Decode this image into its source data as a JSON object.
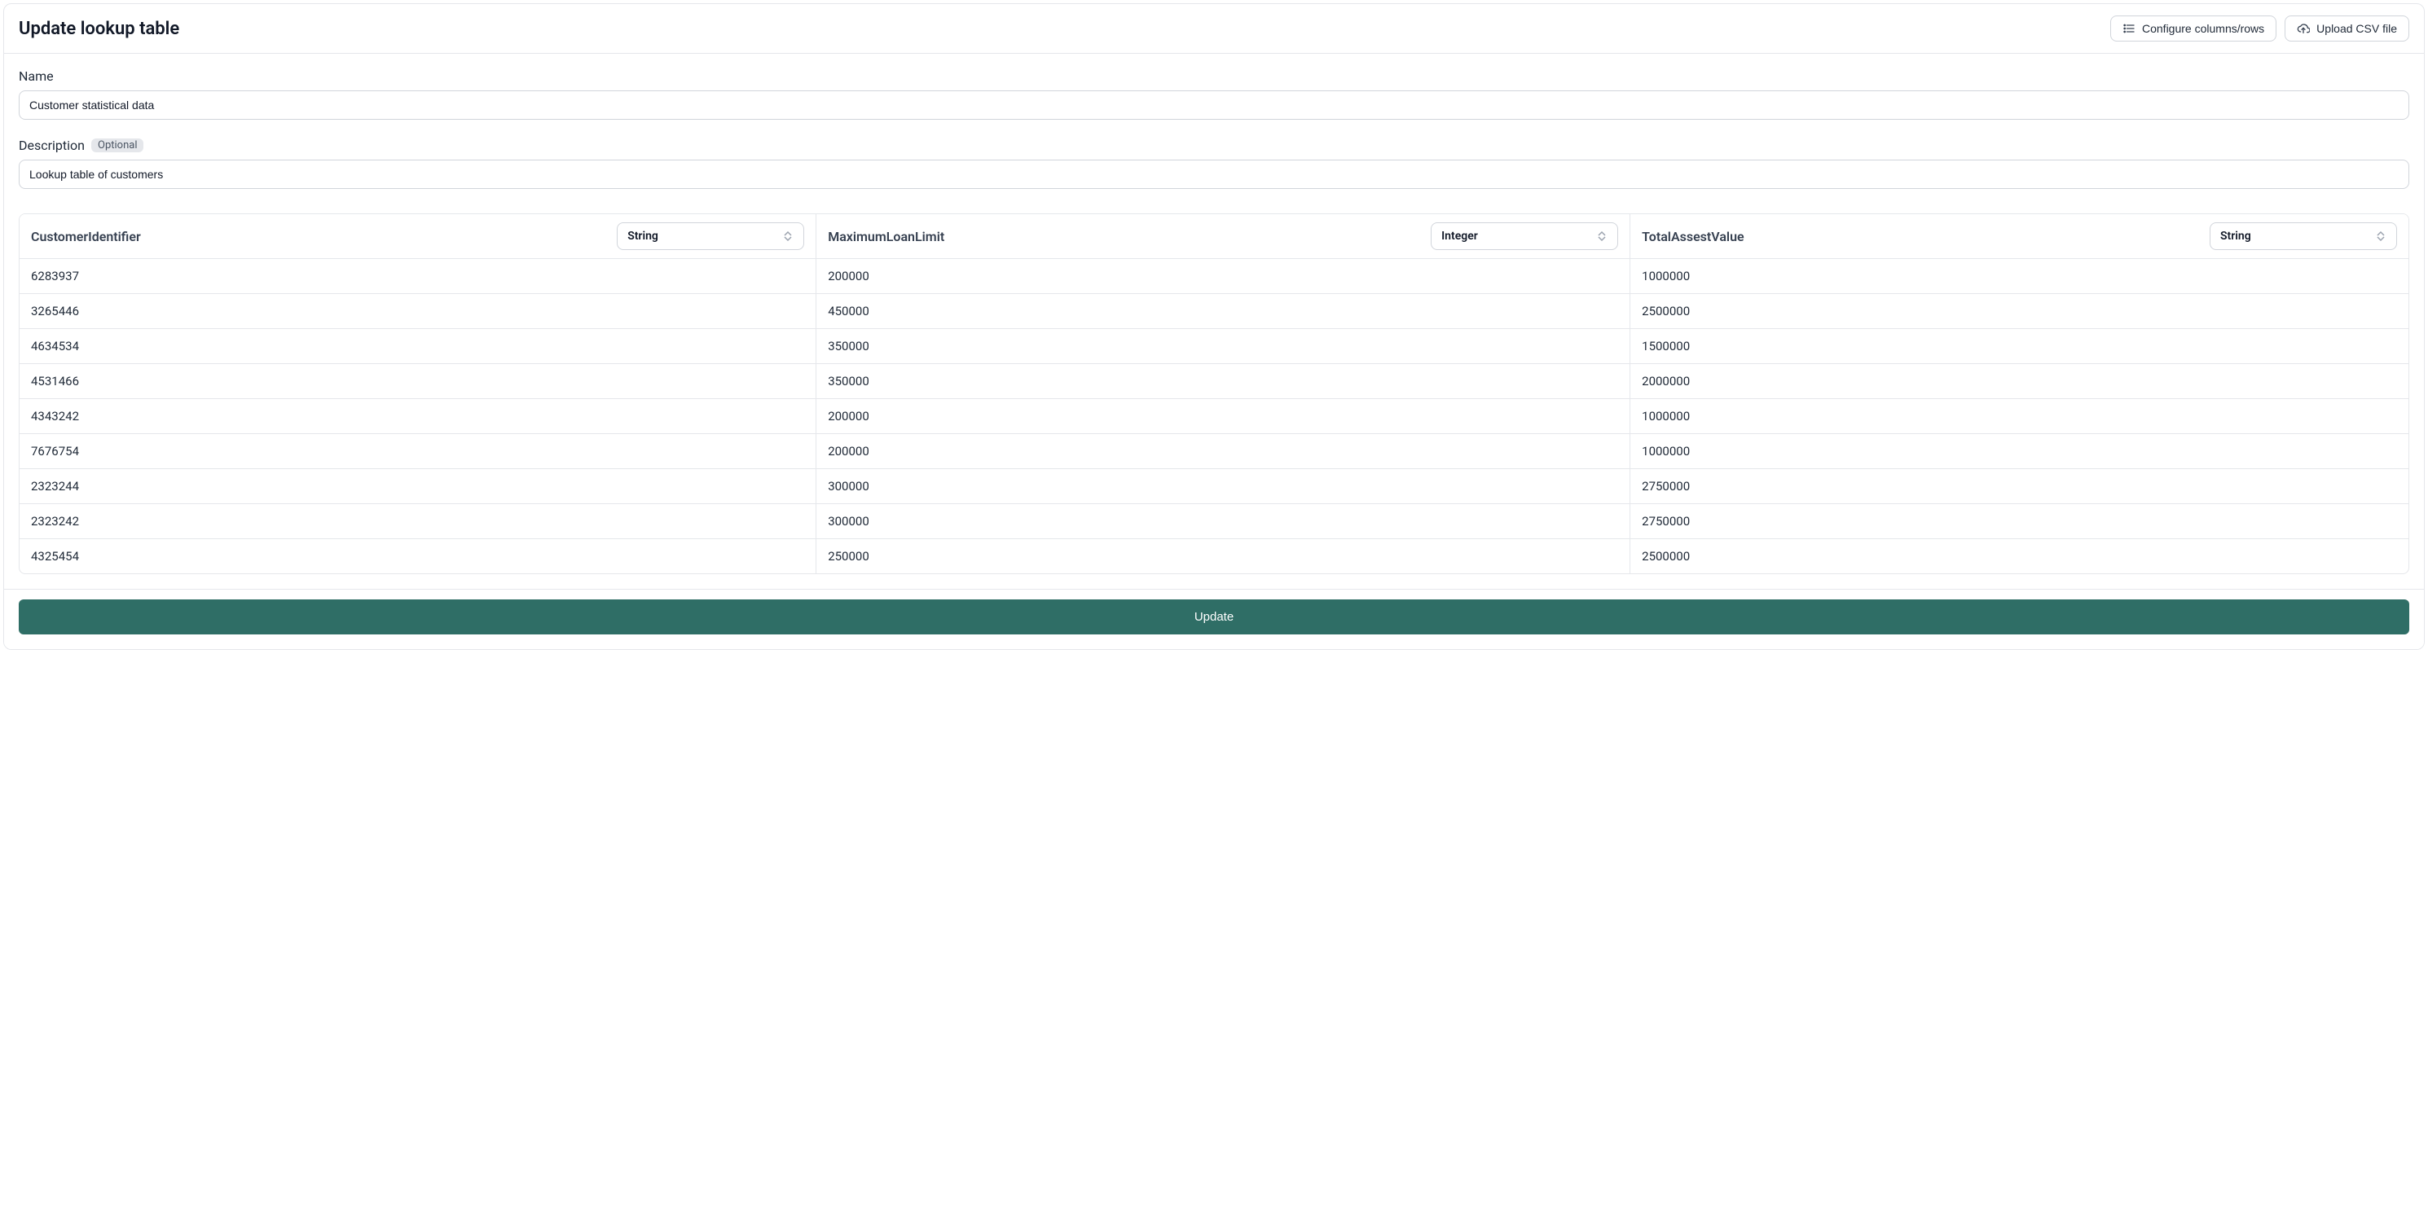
{
  "header": {
    "title": "Update lookup table",
    "configure_label": "Configure columns/rows",
    "upload_label": "Upload CSV file"
  },
  "fields": {
    "name_label": "Name",
    "name_value": "Customer statistical data",
    "description_label": "Description",
    "optional_badge": "Optional",
    "description_value": "Lookup table of customers"
  },
  "table": {
    "columns": [
      {
        "name": "CustomerIdentifier",
        "type": "String"
      },
      {
        "name": "MaximumLoanLimit",
        "type": "Integer"
      },
      {
        "name": "TotalAssestValue",
        "type": "String"
      }
    ],
    "rows": [
      [
        "6283937",
        "200000",
        "1000000"
      ],
      [
        "3265446",
        "450000",
        "2500000"
      ],
      [
        "4634534",
        "350000",
        "1500000"
      ],
      [
        "4531466",
        "350000",
        "2000000"
      ],
      [
        "4343242",
        "200000",
        "1000000"
      ],
      [
        "7676754",
        "200000",
        "1000000"
      ],
      [
        "2323244",
        "300000",
        "2750000"
      ],
      [
        "2323242",
        "300000",
        "2750000"
      ],
      [
        "4325454",
        "250000",
        "2500000"
      ]
    ]
  },
  "footer": {
    "submit_label": "Update"
  }
}
